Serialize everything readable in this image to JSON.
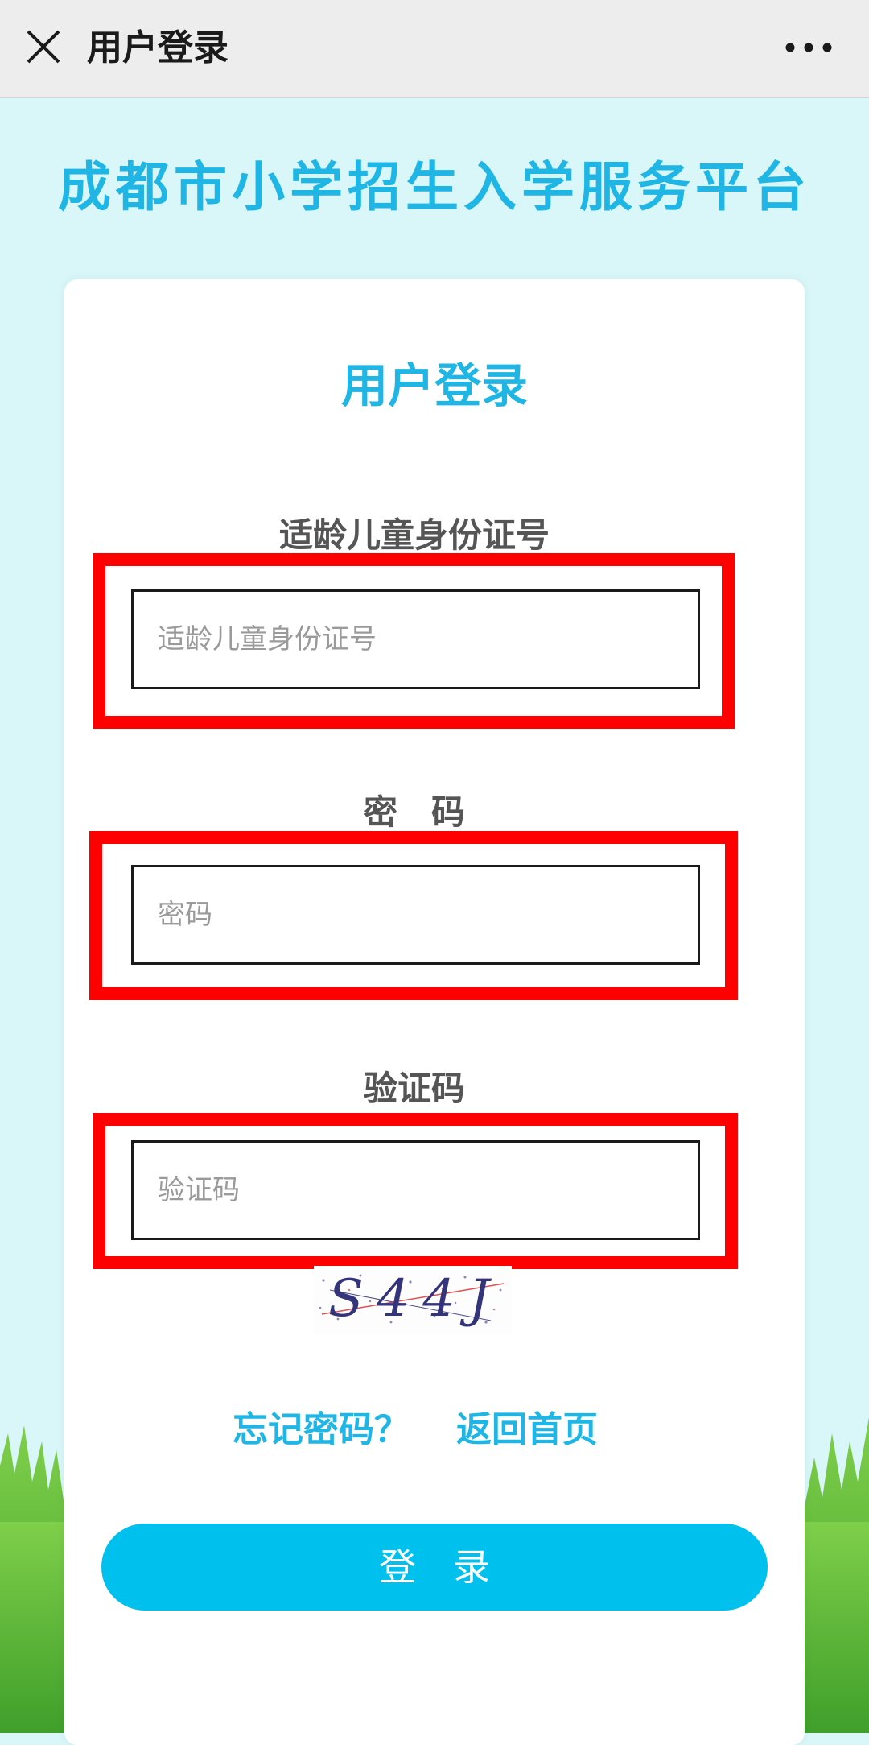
{
  "nav": {
    "title": "用户登录",
    "close_icon": "close-icon",
    "more_icon": "more-icon"
  },
  "page": {
    "heading": "成都市小学招生入学服务平台"
  },
  "card": {
    "title": "用户登录"
  },
  "form": {
    "id_label": "适龄儿童身份证号",
    "id_placeholder": "适龄儿童身份证号",
    "password_label": "密　码",
    "password_placeholder": "密码",
    "captcha_label": "验证码",
    "captcha_placeholder": "验证码",
    "captcha_text": "S44J"
  },
  "links": {
    "forgot_password": "忘记密码？",
    "back_home": "返回首页"
  },
  "buttons": {
    "login": "登　录"
  },
  "colors": {
    "accent": "#1fb6e6",
    "button": "#00c0ee",
    "highlight": "#ff0000",
    "background": "#d9f6f8"
  }
}
